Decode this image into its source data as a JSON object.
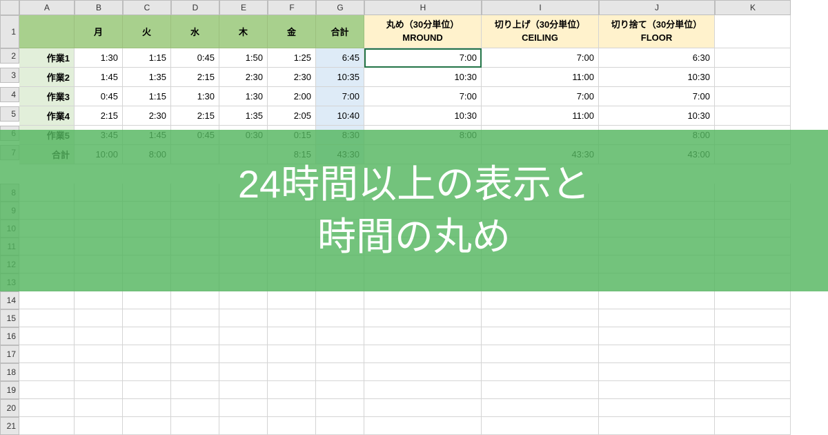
{
  "columns": [
    "A",
    "B",
    "C",
    "D",
    "E",
    "F",
    "G",
    "H",
    "I",
    "J",
    "K"
  ],
  "header": {
    "days": [
      "月",
      "火",
      "水",
      "木",
      "金",
      "合計"
    ],
    "round": "丸め（30分単位）\nMROUND",
    "ceiling": "切り上げ（30分単位）\nCEILING",
    "floor": "切り捨て（30分単位）\nFLOOR"
  },
  "rows": [
    {
      "label": "作業1",
      "vals": [
        "1:30",
        "1:15",
        "0:45",
        "1:50",
        "1:25",
        "6:45",
        "7:00",
        "7:00",
        "6:30"
      ]
    },
    {
      "label": "作業2",
      "vals": [
        "1:45",
        "1:35",
        "2:15",
        "2:30",
        "2:30",
        "10:35",
        "10:30",
        "11:00",
        "10:30"
      ]
    },
    {
      "label": "作業3",
      "vals": [
        "0:45",
        "1:15",
        "1:30",
        "1:30",
        "2:00",
        "7:00",
        "7:00",
        "7:00",
        "7:00"
      ]
    },
    {
      "label": "作業4",
      "vals": [
        "2:15",
        "2:30",
        "2:15",
        "1:35",
        "2:05",
        "10:40",
        "10:30",
        "11:00",
        "10:30"
      ]
    },
    {
      "label": "作業5",
      "vals": [
        "3:45",
        "1:45",
        "0:45",
        "0:30",
        "0:15",
        "8:30",
        "8:00",
        "",
        "8:00"
      ]
    },
    {
      "label": "合計",
      "vals": [
        "10:00",
        "8:00",
        "",
        "",
        "8:15",
        "43:30",
        "",
        "43:30",
        "43:00"
      ]
    }
  ],
  "overlay": {
    "line1": "24時間以上の表示と",
    "line2": "時間の丸め"
  },
  "rownums": [
    "1",
    "2",
    "3",
    "4",
    "5",
    "6",
    "7",
    "8",
    "9",
    "10",
    "11",
    "12",
    "13",
    "14",
    "15",
    "16",
    "17",
    "18",
    "19",
    "20",
    "21"
  ]
}
